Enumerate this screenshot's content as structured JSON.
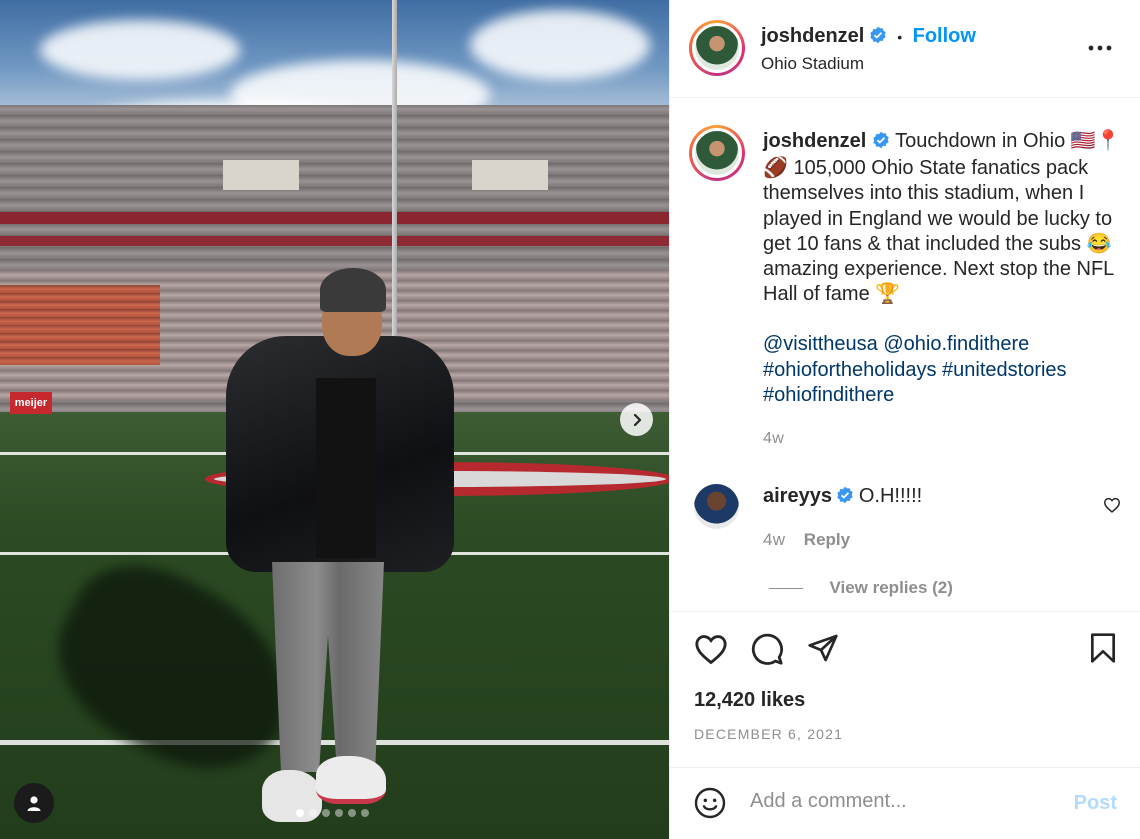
{
  "post": {
    "username": "joshdenzel",
    "separator": "•",
    "follow_label": "Follow",
    "location": "Ohio Stadium"
  },
  "caption": {
    "username": "joshdenzel",
    "text": " Touchdown in Ohio 🇺🇸📍🏈 105,000 Ohio State fanatics pack themselves into this stadium, when I played in England we would be lucky to get 10 fans & that included the subs 😂 amazing experience. Next stop the NFL Hall of fame 🏆",
    "mentions": [
      "@visittheusa",
      "@ohio.findithere"
    ],
    "hashtags": [
      "#ohiofortheholidays",
      "#unitedstories",
      "#ohiofindithere"
    ],
    "time": "4w"
  },
  "comment": {
    "username": "aireyys",
    "text": "O.H!!!!!",
    "time": "4w",
    "reply_label": "Reply",
    "view_replies_label": "View replies (2)"
  },
  "stats": {
    "likes": "12,420 likes",
    "date": "DECEMBER 6, 2021"
  },
  "composer": {
    "placeholder": "Add a comment...",
    "post_label": "Post"
  },
  "photo": {
    "wall_sign": "meijer",
    "carousel_count": 6,
    "carousel_active": 1
  },
  "icons": {
    "verified": "verified-badge-icon",
    "more": "more-options-icon",
    "like": "heart-icon",
    "comment": "comment-bubble-icon",
    "share": "paper-plane-icon",
    "save": "bookmark-icon",
    "emoji": "emoji-smiley-icon",
    "next": "chevron-right-icon",
    "tag": "user-tag-icon"
  },
  "colors": {
    "link": "#0095f6",
    "hashtag": "#00376b",
    "verified": "#3897f0",
    "muted": "#8e8e8e",
    "post_disabled": "#b3dbff"
  }
}
